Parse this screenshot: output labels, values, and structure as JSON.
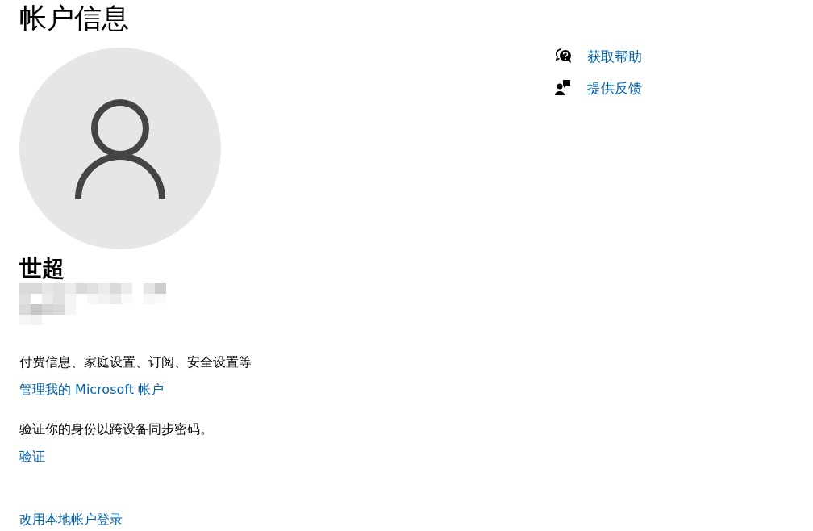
{
  "page_title": "帐户信息",
  "account": {
    "name": "世超"
  },
  "sections": [
    {
      "description": "付费信息、家庭设置、订阅、安全设置等",
      "link": "管理我的 Microsoft 帐户"
    },
    {
      "description": "验证你的身份以跨设备同步密码。",
      "link": "验证"
    }
  ],
  "bottom_link": "改用本地帐户登录",
  "help_links": [
    {
      "kind": "help",
      "label": "获取帮助"
    },
    {
      "kind": "feedback",
      "label": "提供反馈"
    }
  ]
}
